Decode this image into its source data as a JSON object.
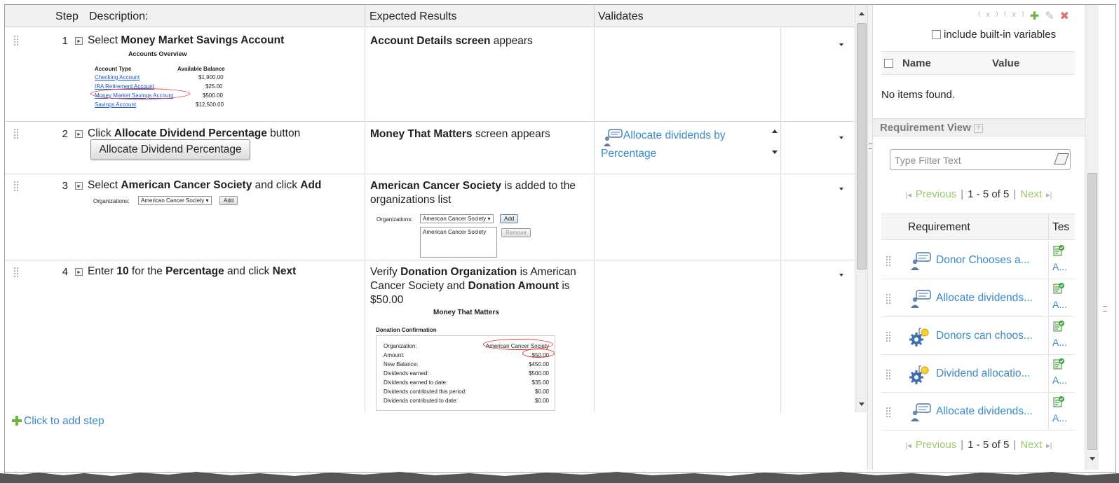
{
  "table": {
    "headers": {
      "step": "Step",
      "description": "Description:",
      "expected": "Expected Results",
      "validates": "Validates"
    },
    "rows": [
      {
        "num": "1",
        "desc_pre": "Select ",
        "desc_bold": "Money Market Savings Account",
        "desc_post": "",
        "exp_bold": "Account Details screen",
        "exp_post": " appears",
        "mini": {
          "title": "Accounts Overview",
          "col1": "Account Type",
          "col2": "Available Balance",
          "accounts": [
            {
              "name": "Checking Account",
              "balance": "$1,900.00"
            },
            {
              "name": "IRA Retirement Account",
              "balance": "$25.00"
            },
            {
              "name": "Money Market Savings Account",
              "balance": "$500.00"
            },
            {
              "name": "Savings Account",
              "balance": "$12,500.00"
            }
          ]
        }
      },
      {
        "num": "2",
        "desc_pre": "Click ",
        "desc_bold": "Allocate Dividend Percentage",
        "desc_post": " button",
        "button_label": "Allocate Dividend Percentage",
        "exp_bold": "Money That Matters",
        "exp_post": " screen appears",
        "validates_link": "Allocate dividends by Percentage"
      },
      {
        "num": "3",
        "desc_pre": "Select ",
        "desc_bold": "American Cancer Society",
        "desc_mid": " and click ",
        "desc_bold2": "Add",
        "mini": {
          "label": "Organizations:",
          "select": "American Cancer Society",
          "add": "Add",
          "list_item": "American Cancer Society",
          "remove": "Remove"
        },
        "exp_bold": "American Cancer Society",
        "exp_post": " is added to the organizations list"
      },
      {
        "num": "4",
        "desc_pre": "Enter ",
        "desc_bold": "10",
        "desc_mid": " for the ",
        "desc_bold2": "Percentage",
        "desc_mid2": " and click ",
        "desc_bold3": "Next",
        "exp_pre": "Verify ",
        "exp_bold": "Donation Organization",
        "exp_mid": " is American Cancer Society and ",
        "exp_bold2": "Donation Amount",
        "exp_post": " is $50.00",
        "mini": {
          "title": "Money That Matters",
          "section": "Donation Confirmation",
          "lines": [
            {
              "label": "Organization:",
              "value": "American Cancer Society"
            },
            {
              "label": "Amount:",
              "value": "$50.00"
            },
            {
              "label": "New Balance:",
              "value": "$450.00"
            },
            {
              "label": "Dividends earned:",
              "value": "$500.00"
            },
            {
              "label": "Dividends earned to date:",
              "value": "$35.00"
            },
            {
              "label": "Dividends contributed this period:",
              "value": "$0.00"
            },
            {
              "label": "Dividends contributed to date:",
              "value": "$0.00"
            }
          ]
        }
      }
    ],
    "add_step": "Click to add step"
  },
  "variables": {
    "include_builtin": "include built-in variables",
    "col_name": "Name",
    "col_value": "Value",
    "empty": "No items found."
  },
  "requirements": {
    "section_title": "Requirement View",
    "filter_placeholder": "Type Filter Text",
    "pager": {
      "prev": "Previous",
      "range": "1 - 5 of 5",
      "next": "Next"
    },
    "col_requirement": "Requirement",
    "col_test": "Tes",
    "items": [
      {
        "label": "Donor Chooses a...",
        "type": "comment",
        "test": "A..."
      },
      {
        "label": "Allocate dividends...",
        "type": "comment",
        "test": "A..."
      },
      {
        "label": "Donors can choos...",
        "type": "gear",
        "test": "A..."
      },
      {
        "label": "Dividend allocatio...",
        "type": "gear",
        "test": "A..."
      },
      {
        "label": "Allocate dividends...",
        "type": "comment",
        "test": "A..."
      }
    ]
  },
  "colors": {
    "link": "#3a8ac8",
    "pager_link": "#9bc96a",
    "header_bg": "#f1f1f1",
    "remove_x": "#e07070"
  }
}
